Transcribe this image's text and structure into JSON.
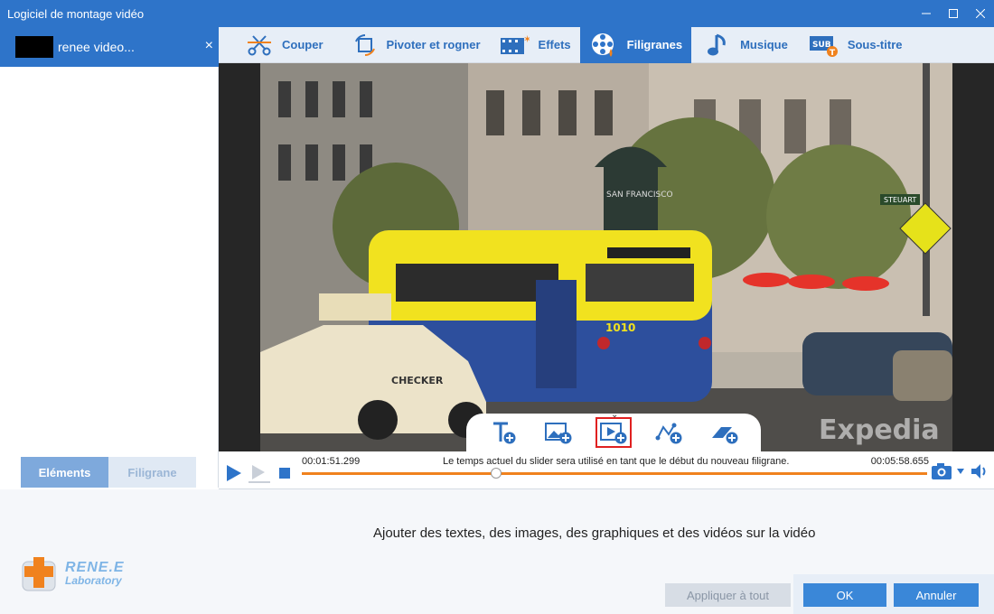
{
  "window": {
    "title": "Logiciel de montage vidéo"
  },
  "file_tab": {
    "name": "renee video...",
    "close": "×"
  },
  "toolbar": {
    "tabs": [
      {
        "label": "Couper",
        "icon": "cut-icon"
      },
      {
        "label": "Pivoter et rogner",
        "icon": "rotate-crop-icon"
      },
      {
        "label": "Effets",
        "icon": "effects-icon"
      },
      {
        "label": "Filigranes",
        "icon": "watermark-icon",
        "active": true
      },
      {
        "label": "Musique",
        "icon": "music-icon"
      },
      {
        "label": "Sous-titre",
        "icon": "subtitle-icon"
      }
    ]
  },
  "left_tabs": {
    "elements": "Eléments",
    "filigrane": "Filigrane"
  },
  "timeline": {
    "current_time": "00:01:51.299",
    "end_time": "00:05:58.655",
    "hint": "Le temps actuel du slider sera utilisé en tant que le début du nouveau filigrane.",
    "progress": 0.31
  },
  "video": {
    "signs": {
      "san_francisco": "SAN FRANCISCO",
      "steuart": "STEUART",
      "tram_number": "1010",
      "taxi": "CHECKER",
      "watermark": "Expedia"
    }
  },
  "bottom": {
    "description": "Ajouter des textes, des images, des graphiques et des vidéos sur la vidéo",
    "apply_all": "Appliquer à tout",
    "ok": "OK",
    "cancel": "Annuler",
    "logo_line1": "RENE.E",
    "logo_line2": "Laboratory"
  },
  "colors": {
    "accent": "#2e74c9",
    "track": "#f0821e",
    "button": "#3a87d8"
  }
}
